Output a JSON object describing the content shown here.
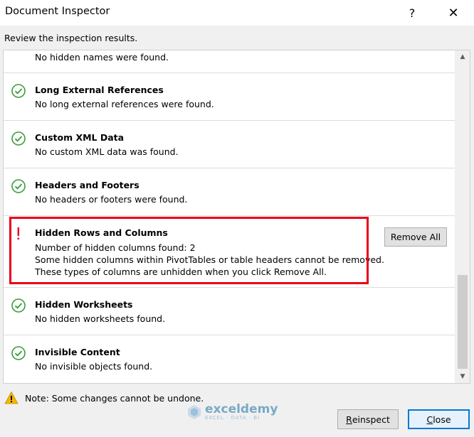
{
  "window": {
    "title": "Document Inspector",
    "help_glyph": "?",
    "close_glyph": "✕"
  },
  "instruction": "Review the inspection results.",
  "items": [
    {
      "name": "",
      "desc": "No hidden names were found.",
      "status": "ok"
    },
    {
      "name": "Long External References",
      "desc": "No long external references were found.",
      "status": "ok"
    },
    {
      "name": "Custom XML Data",
      "desc": "No custom XML data was found.",
      "status": "ok"
    },
    {
      "name": "Headers and Footers",
      "desc": "No headers or footers were found.",
      "status": "ok"
    },
    {
      "name": "Hidden Rows and Columns",
      "desc": "Number of hidden columns found: 2\nSome hidden columns within PivotTables or table headers cannot be removed.\nThese types of columns are unhidden when you click Remove All.",
      "status": "warning"
    },
    {
      "name": "Hidden Worksheets",
      "desc": "No hidden worksheets found.",
      "status": "ok"
    },
    {
      "name": "Invisible Content",
      "desc": "No invisible objects found.",
      "status": "ok"
    }
  ],
  "remove_all_label": "Remove All",
  "note": "Note: Some changes cannot be undone.",
  "buttons": {
    "reinspect_underline": "R",
    "reinspect_rest": "einspect",
    "close_underline": "C",
    "close_rest": "lose"
  },
  "watermark": {
    "name": "exceldemy",
    "tagline": "EXCEL · DATA · BI"
  },
  "colors": {
    "ok_green": "#3a9d3a",
    "warning_red": "#e8001c",
    "highlight_border": "#e8001c",
    "accent_blue": "#0078d7"
  },
  "icons": {
    "ok": "check-circle-icon",
    "warning": "exclamation-icon",
    "note": "warning-triangle-icon"
  }
}
